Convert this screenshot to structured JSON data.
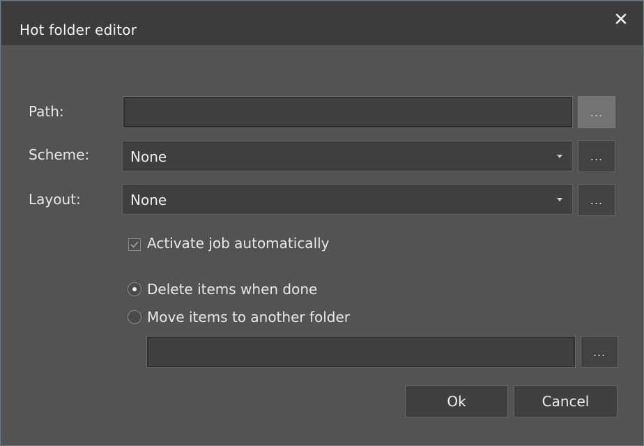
{
  "window": {
    "title": "Hot folder editor"
  },
  "form": {
    "path_label": "Path:",
    "path_value": "",
    "path_browse": "...",
    "scheme_label": "Scheme:",
    "scheme_value": "None",
    "scheme_browse": "...",
    "layout_label": "Layout:",
    "layout_value": "None",
    "layout_browse": "..."
  },
  "options": {
    "activate_label": "Activate job automatically",
    "activate_checked": true,
    "delete_label": "Delete items when done",
    "delete_selected": true,
    "move_label": "Move items to another folder",
    "move_selected": false,
    "move_path_value": "",
    "move_browse": "..."
  },
  "buttons": {
    "ok": "Ok",
    "cancel": "Cancel"
  },
  "icons": {
    "close": "close-icon",
    "dropdown": "chevron-down-icon",
    "check": "checkmark-icon"
  },
  "colors": {
    "dialog_bg": "#535353",
    "titlebar_bg": "#3c3c3c",
    "field_bg": "#3f3f3f",
    "accent_border": "#6d7a8a"
  }
}
